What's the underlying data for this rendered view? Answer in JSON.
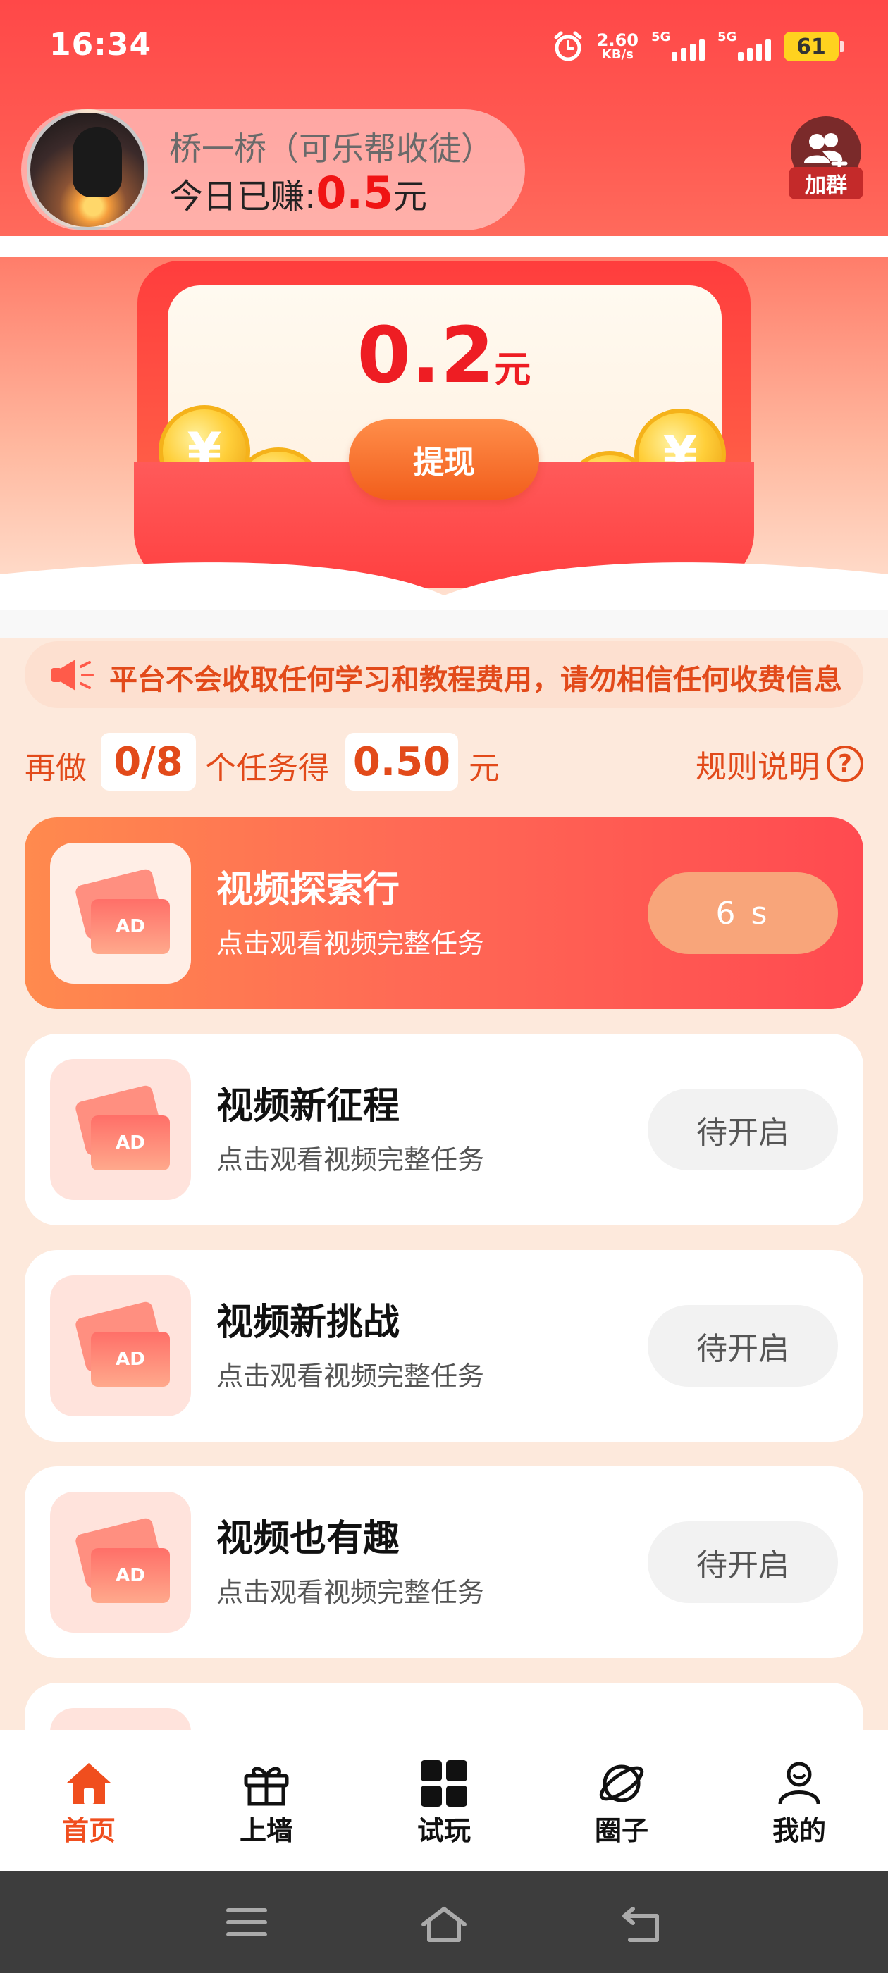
{
  "status_bar": {
    "time": "16:34",
    "net_speed_value": "2.60",
    "net_speed_unit": "KB/s",
    "sim1": "5G",
    "sim2": "5G",
    "battery": "61"
  },
  "user": {
    "name": "桥一桥（可乐帮收徒）",
    "earned_prefix": "今日已赚:",
    "earned_amount": "0.5",
    "earned_unit": "元"
  },
  "join_group": {
    "label": "加群"
  },
  "banner": {
    "amount": "0.2",
    "unit": "元",
    "withdraw_label": "提现",
    "coin_symbol": "¥"
  },
  "notice": {
    "text": "平台不会收取任何学习和教程费用，请勿相信任何收费信息"
  },
  "progress": {
    "prefix": "再做",
    "count": "0/8",
    "middle": "个任务得",
    "reward": "0.50",
    "unit": "元",
    "rules_label": "规则说明",
    "rules_icon": "?"
  },
  "tasks": [
    {
      "badge": "AD",
      "title": "视频探索行",
      "subtitle": "点击观看视频完整任务",
      "action": "6 s"
    },
    {
      "badge": "AD",
      "title": "视频新征程",
      "subtitle": "点击观看视频完整任务",
      "action": "待开启"
    },
    {
      "badge": "AD",
      "title": "视频新挑战",
      "subtitle": "点击观看视频完整任务",
      "action": "待开启"
    },
    {
      "badge": "AD",
      "title": "视频也有趣",
      "subtitle": "点击观看视频完整任务",
      "action": "待开启"
    }
  ],
  "nav": [
    {
      "label": "首页",
      "icon": "home-icon"
    },
    {
      "label": "上墙",
      "icon": "gift-icon"
    },
    {
      "label": "试玩",
      "icon": "grid-icon"
    },
    {
      "label": "圈子",
      "icon": "planet-icon"
    },
    {
      "label": "我的",
      "icon": "user-icon"
    }
  ],
  "colors": {
    "accent_red": "#ee1d23",
    "accent_orange": "#e24a1a",
    "nav_active": "#f04e1e"
  }
}
